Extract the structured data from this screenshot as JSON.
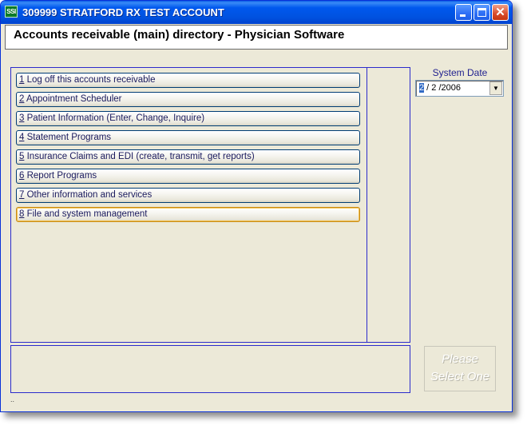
{
  "window": {
    "icon_text": "SSI",
    "title": "309999 STRATFORD RX TEST ACCOUNT"
  },
  "header": {
    "title": "Accounts receivable (main) directory - Physician Software"
  },
  "menu": {
    "items": [
      {
        "num": "1",
        "label": " Log off this accounts receivable"
      },
      {
        "num": "2",
        "label": " Appointment Scheduler"
      },
      {
        "num": "3",
        "label": " Patient Information (Enter, Change, Inquire)"
      },
      {
        "num": "4",
        "label": " Statement Programs"
      },
      {
        "num": "5",
        "label": " Insurance Claims and EDI (create, transmit, get reports)"
      },
      {
        "num": "6",
        "label": " Report Programs"
      },
      {
        "num": "7",
        "label": " Other information and services"
      },
      {
        "num": "8",
        "label": " File and system management"
      }
    ]
  },
  "system_date": {
    "label": "System Date",
    "month": "2",
    "rest": " / 2 /2006"
  },
  "select_button": {
    "line1": "Please",
    "line2": "Select One"
  },
  "status": {
    "text": ".."
  },
  "colors": {
    "titlebar": "#0054e3",
    "panel_border": "#2b2bcc",
    "window_bg": "#ece9d8",
    "focus_border": "#f7c24a"
  }
}
